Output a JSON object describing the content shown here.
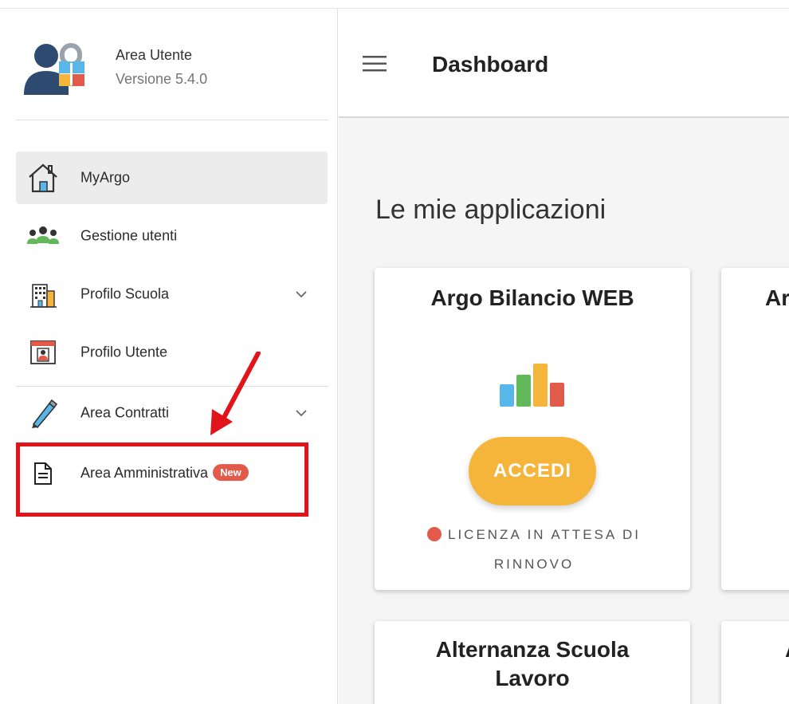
{
  "brand": {
    "title": "Area Utente",
    "version": "Versione 5.4.0"
  },
  "sidebar": {
    "items": [
      {
        "label": "MyArgo",
        "icon": "home-icon",
        "active": true
      },
      {
        "label": "Gestione utenti",
        "icon": "users-icon"
      },
      {
        "label": "Profilo Scuola",
        "icon": "school-building-icon",
        "expandable": true
      },
      {
        "label": "Profilo Utente",
        "icon": "user-profile-card-icon"
      },
      {
        "label": "Area Contratti",
        "icon": "pen-icon",
        "expandable": true
      },
      {
        "label": "Area Amministrativa",
        "icon": "document-icon",
        "badge": "New"
      }
    ]
  },
  "topbar": {
    "title": "Dashboard"
  },
  "main": {
    "section_title": "Le mie applicazioni",
    "cards": [
      {
        "title": "Argo Bilancio WEB",
        "button_label": "ACCEDI",
        "status_line1": "LICENZA IN ATTESA DI",
        "status_line2": "RINNOVO"
      },
      {
        "title": "Ar"
      },
      {
        "title_line1": "Alternanza Scuola",
        "title_line2": "Lavoro"
      },
      {
        "title": "A"
      }
    ]
  },
  "colors": {
    "accent_button": "#f5b53a",
    "badge": "#e25a4a",
    "highlight": "#e0141a"
  }
}
